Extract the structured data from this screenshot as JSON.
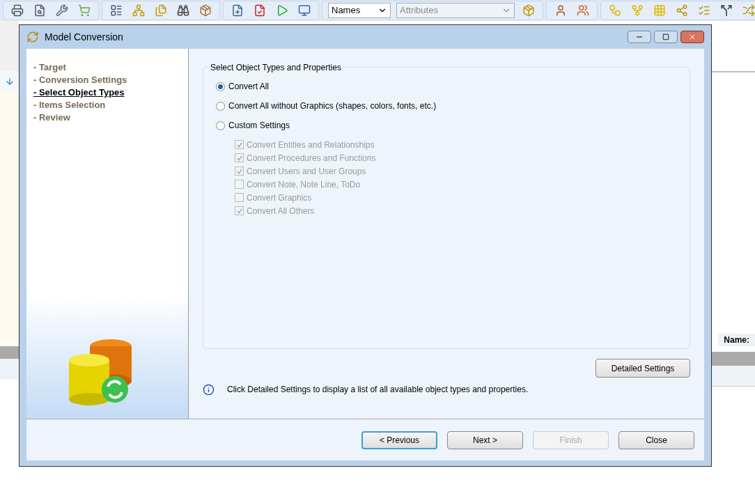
{
  "toolbar": {
    "names_dropdown": {
      "value": "Names"
    },
    "attributes_dropdown": {
      "placeholder": "Attributes"
    }
  },
  "background": {
    "name_label": "Name:"
  },
  "dialog": {
    "title": "Model Conversion",
    "steps": [
      {
        "label": "- Target",
        "selected": false
      },
      {
        "label": "- Conversion Settings",
        "selected": false
      },
      {
        "label": "- Select Object Types",
        "selected": true
      },
      {
        "label": "- Items Selection",
        "selected": false
      },
      {
        "label": "- Review",
        "selected": false
      }
    ],
    "group_title": "Select Object Types and Properties",
    "options": [
      {
        "label": "Convert All",
        "selected": true
      },
      {
        "label": "Convert All without Graphics (shapes, colors, fonts, etc.)",
        "selected": false
      },
      {
        "label": "Custom Settings",
        "selected": false
      }
    ],
    "custom_items": [
      {
        "label": "Convert Entities and Relationships",
        "checked": true,
        "disabled": true
      },
      {
        "label": "Convert Procedures and Functions",
        "checked": true,
        "disabled": true
      },
      {
        "label": "Convert Users and User Groups",
        "checked": true,
        "disabled": true
      },
      {
        "label": "Convert Note, Note Line, ToDo",
        "checked": false,
        "disabled": true
      },
      {
        "label": "Convert Graphics",
        "checked": false,
        "disabled": true
      },
      {
        "label": "Convert All Others",
        "checked": true,
        "disabled": true
      }
    ],
    "detailed_button": "Detailed Settings",
    "info_text": "Click Detailed Settings to display a list of all available object types and properties.",
    "buttons": [
      {
        "label": "< Previous",
        "disabled": false,
        "focused": true
      },
      {
        "label": "Next >",
        "disabled": false,
        "focused": false
      },
      {
        "label": "Finish",
        "disabled": true,
        "focused": false
      },
      {
        "label": "Close",
        "disabled": false,
        "focused": false
      }
    ]
  }
}
